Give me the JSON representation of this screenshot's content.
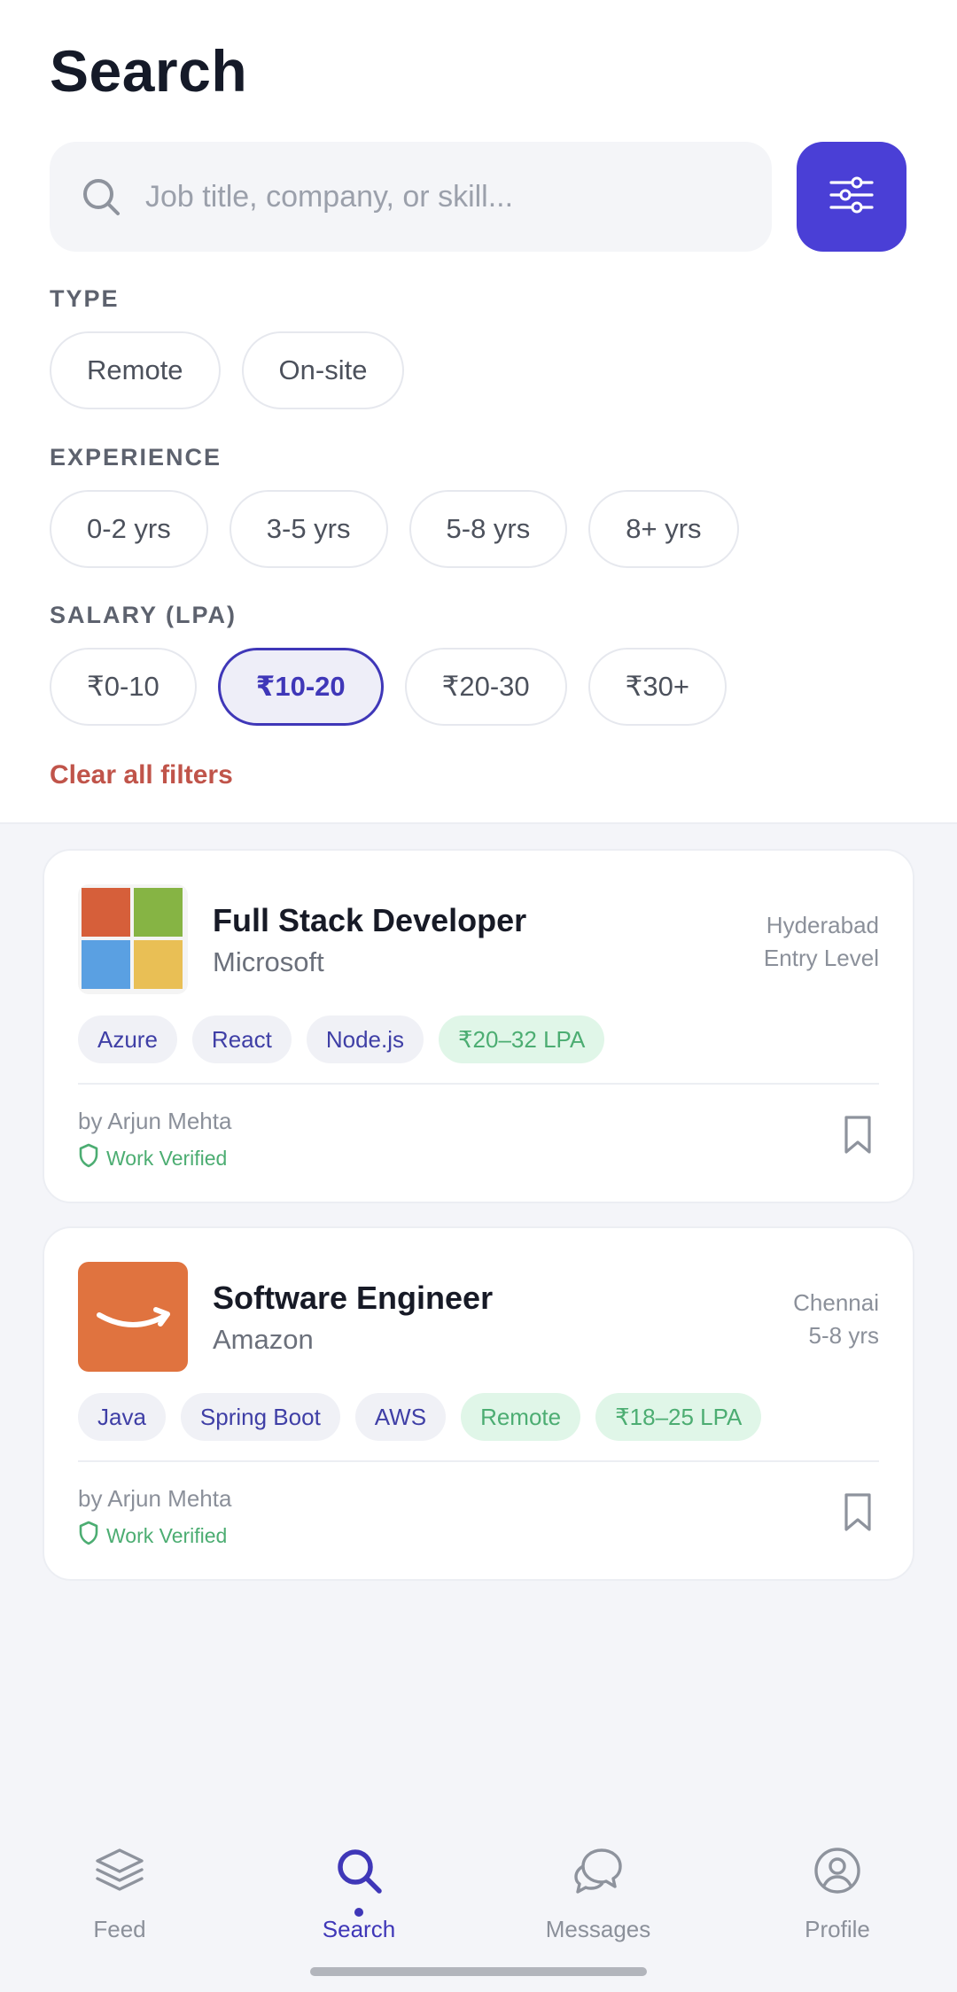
{
  "header": {
    "title": "Search"
  },
  "search": {
    "placeholder": "Job title, company, or skill..."
  },
  "filters": {
    "type": {
      "label": "TYPE",
      "options": [
        "Remote",
        "On-site"
      ]
    },
    "experience": {
      "label": "EXPERIENCE",
      "options": [
        "0-2 yrs",
        "3-5 yrs",
        "5-8 yrs",
        "8+ yrs"
      ]
    },
    "salary": {
      "label": "SALARY (LPA)",
      "options": [
        "₹0-10",
        "₹10-20",
        "₹20-30",
        "₹30+"
      ],
      "selected": "₹10-20"
    },
    "clear_label": "Clear all filters"
  },
  "jobs": [
    {
      "title": "Full Stack Developer",
      "company": "Microsoft",
      "location": "Hyderabad",
      "level": "Entry Level",
      "tags": [
        "Azure",
        "React",
        "Node.js"
      ],
      "salary": "₹20–32 LPA",
      "author": "by Arjun Mehta",
      "verified": "Work Verified"
    },
    {
      "title": "Software Engineer",
      "company": "Amazon",
      "location": "Chennai",
      "level": "5-8 yrs",
      "tags": [
        "Java",
        "Spring Boot",
        "AWS"
      ],
      "mode": "Remote",
      "salary": "₹18–25 LPA",
      "author": "by Arjun Mehta",
      "verified": "Work Verified"
    }
  ],
  "nav": {
    "items": [
      {
        "label": "Feed",
        "icon": "layers-icon"
      },
      {
        "label": "Search",
        "icon": "search-icon"
      },
      {
        "label": "Messages",
        "icon": "chat-icon"
      },
      {
        "label": "Profile",
        "icon": "user-circle-icon"
      }
    ],
    "active": "Search"
  },
  "colors": {
    "accent": "#4a3fd6",
    "selected_text": "#3f37b8",
    "danger": "#c0544a",
    "success": "#4cad72",
    "microsoft_logo": [
      "#d65f3a",
      "#86b444",
      "#5aa0e2",
      "#e9bf55"
    ],
    "amazon_logo": "#e0733f"
  }
}
